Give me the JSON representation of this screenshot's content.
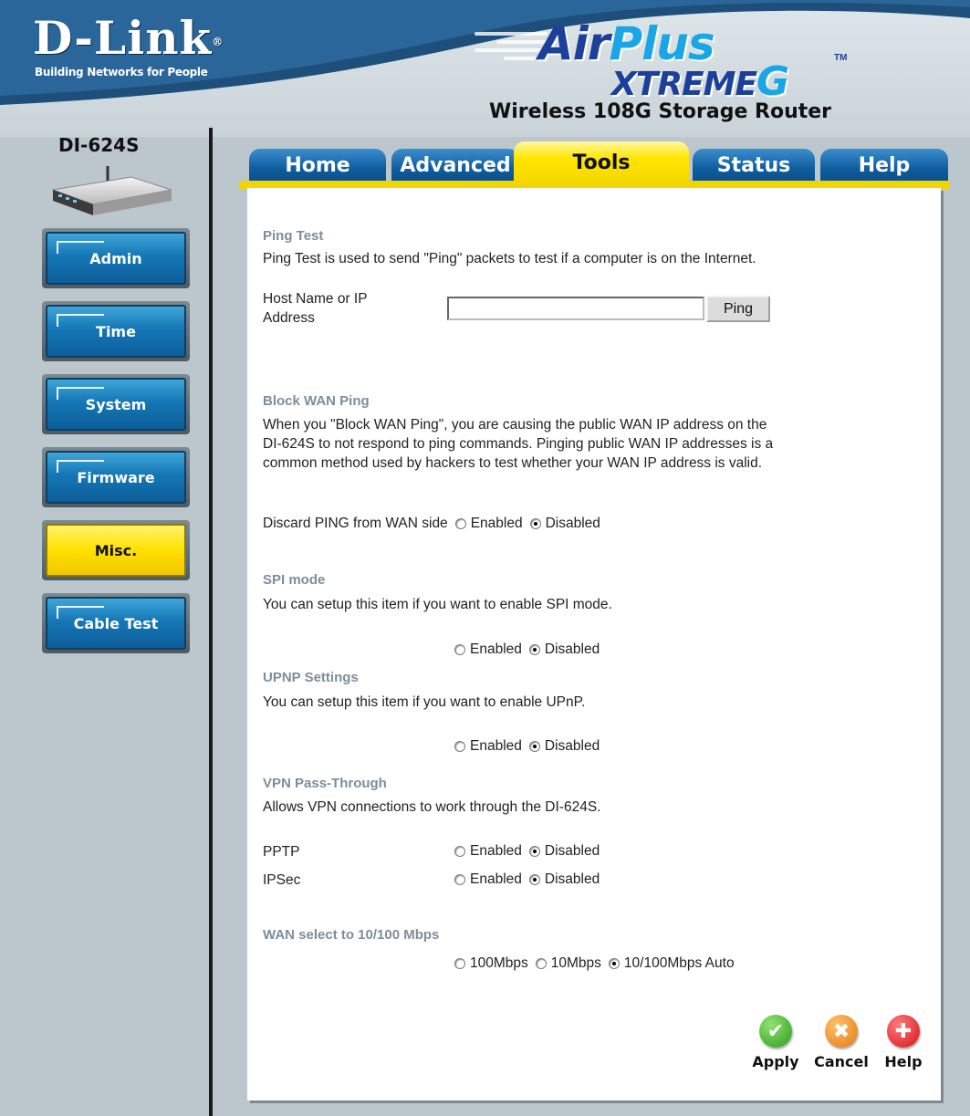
{
  "brand": {
    "logo": "D-Link",
    "tagline": "Building Networks for People",
    "product_line": "AirPlus XtremeG",
    "product_title": "Wireless 108G Storage Router",
    "model": "DI-624S"
  },
  "tabs": [
    {
      "label": "Home",
      "active": false
    },
    {
      "label": "Advanced",
      "active": false
    },
    {
      "label": "Tools",
      "active": true
    },
    {
      "label": "Status",
      "active": false
    },
    {
      "label": "Help",
      "active": false
    }
  ],
  "sidebar": {
    "items": [
      {
        "label": "Admin",
        "active": false
      },
      {
        "label": "Time",
        "active": false
      },
      {
        "label": "System",
        "active": false
      },
      {
        "label": "Firmware",
        "active": false
      },
      {
        "label": "Misc.",
        "active": true
      },
      {
        "label": "Cable Test",
        "active": false
      }
    ]
  },
  "ping_test": {
    "title": "Ping Test",
    "description": "Ping Test is used to send \"Ping\" packets to test if a computer is on the Internet.",
    "host_label_line1": "Host Name or IP",
    "host_label_line2": "Address",
    "host_value": "",
    "ping_button": "Ping"
  },
  "block_wan_ping": {
    "title": "Block WAN Ping",
    "description_line1": "When you \"Block WAN Ping\", you are causing the public WAN IP address on the",
    "description_line2": "DI-624S to not respond to ping commands. Pinging public WAN IP addresses is a",
    "description_line3": "common method used by hackers to test whether your WAN IP address is valid.",
    "discard_label": "Discard PING from WAN side",
    "options": [
      "Enabled",
      "Disabled"
    ],
    "selected": "Disabled"
  },
  "spi_mode": {
    "title": "SPI mode",
    "description": "You can setup this item if you want to enable SPI mode.",
    "options": [
      "Enabled",
      "Disabled"
    ],
    "selected": "Disabled"
  },
  "upnp": {
    "title": "UPNP Settings",
    "description": "You can setup this item if you want to enable UPnP.",
    "options": [
      "Enabled",
      "Disabled"
    ],
    "selected": "Disabled"
  },
  "vpn": {
    "title": "VPN Pass-Through",
    "description": "Allows VPN connections to work through the DI-624S.",
    "pptp_label": "PPTP",
    "ipsec_label": "IPSec",
    "options": [
      "Enabled",
      "Disabled"
    ],
    "pptp_selected": "Disabled",
    "ipsec_selected": "Disabled"
  },
  "wan_speed": {
    "title": "WAN select to 10/100 Mbps",
    "options": [
      "100Mbps",
      "10Mbps",
      "10/100Mbps Auto"
    ],
    "selected": "10/100Mbps Auto"
  },
  "actions": {
    "apply": "Apply",
    "cancel": "Cancel",
    "help": "Help"
  },
  "colors": {
    "tab_blue": "#0f5c9e",
    "tab_active_yellow": "#ffe500",
    "section_title": "#7c8e9b",
    "apply_green": "#3fb52b",
    "cancel_orange": "#f08a1c",
    "help_red": "#e0202a"
  }
}
